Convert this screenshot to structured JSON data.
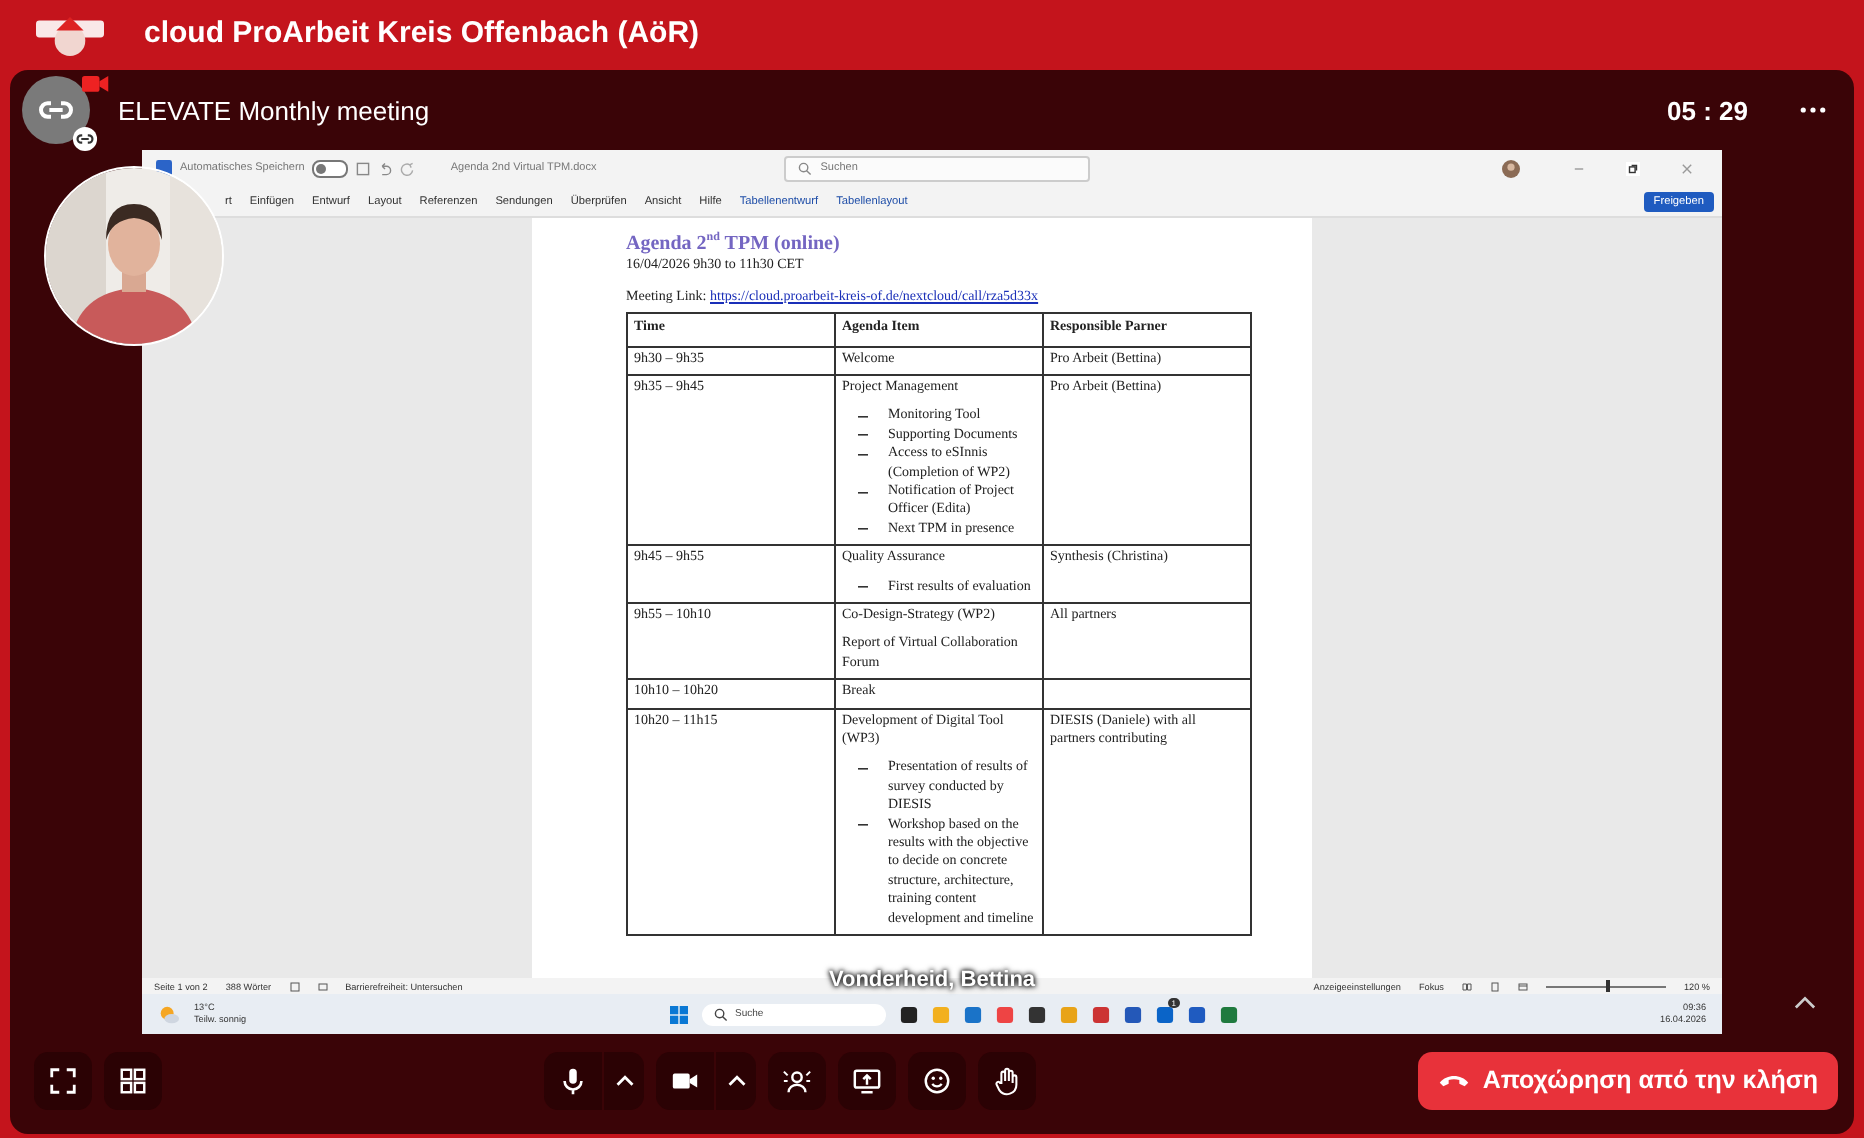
{
  "app_bar": {
    "title": "cloud ProArbeit Kreis Offenbach (AöR)"
  },
  "call": {
    "title": "ELEVATE Monthly meeting",
    "timer": "05 : 29"
  },
  "word": {
    "autosave_label": "Automatisches Speichern",
    "autosave_on": false,
    "file_name": "Agenda 2nd Virtual TPM.docx",
    "search_placeholder": "Suchen",
    "share_button": "Freigeben",
    "ribbon_tabs": [
      {
        "label": "rt",
        "kind": "normal"
      },
      {
        "label": "Einfügen",
        "kind": "normal"
      },
      {
        "label": "Entwurf",
        "kind": "normal"
      },
      {
        "label": "Layout",
        "kind": "normal"
      },
      {
        "label": "Referenzen",
        "kind": "normal"
      },
      {
        "label": "Sendungen",
        "kind": "normal"
      },
      {
        "label": "Überprüfen",
        "kind": "normal"
      },
      {
        "label": "Ansicht",
        "kind": "normal"
      },
      {
        "label": "Hilfe",
        "kind": "normal"
      },
      {
        "label": "Tabellenentwurf",
        "kind": "context"
      },
      {
        "label": "Tabellenlayout",
        "kind": "context"
      }
    ]
  },
  "document": {
    "title": "Agenda 2$^{nd}$ TPM (online)",
    "date_line": "16/04/2026 9h30 to 11h30 CET",
    "link_label": "Meeting Link:",
    "link": "https://cloud.proarbeit-kreis-of.de/nextcloud/call/rza5d33x",
    "columns": [
      "Time",
      "Agenda Item",
      "Responsible Parner"
    ],
    "rows": [
      {
        "time": "9h30 – 9h35",
        "paragraphs": [
          "Welcome"
        ],
        "partner": "Pro Arbeit (Bettina)"
      },
      {
        "time": "9h35 – 9h45",
        "paragraphs": [
          "Project Management"
        ],
        "bullets": [
          "Monitoring Tool",
          "Supporting Documents",
          "Access to eSInnis (Completion of WP2)",
          "Notification of Project Officer (Edita)",
          "Next TPM in presence"
        ],
        "partner": "Pro Arbeit (Bettina)"
      },
      {
        "time": "9h45 – 9h55",
        "paragraphs": [
          "Quality Assurance"
        ],
        "bullets": [
          "First results of evaluation"
        ],
        "partner": "Synthesis (Christina)"
      },
      {
        "time": "9h55 – 10h10",
        "paragraphs": [
          "Co-Design-Strategy (WP2)",
          "Report of Virtual Collaboration Forum"
        ],
        "partner": "All partners"
      },
      {
        "time": "10h10 – 10h20",
        "paragraphs": [
          "Break"
        ]
      },
      {
        "time": "10h20 – 11h15",
        "paragraphs": [
          "Development of Digital Tool (WP3)"
        ],
        "bullets": [
          "Presentation of results of survey conducted by DIESIS",
          "Workshop based on the results with the objective to decide on concrete structure, architecture, training content development and timeline"
        ],
        "partner": "DIESIS (Daniele) with all partners contributing"
      }
    ]
  },
  "status_bar": {
    "page": "Seite 1 von 2",
    "words": "388 Wörter",
    "accessibility": "Barrierefreiheit: Untersuchen",
    "display_settings": "Anzeigeeinstellungen",
    "focus": "Fokus",
    "zoom_slider": {
      "level": 0.5
    },
    "zoom": "120 %"
  },
  "taskbar": {
    "temperature": "13°C",
    "weather": "Teilw. sonnig",
    "search_placeholder": "Suche",
    "time": "09:36",
    "date": "16.04.2026",
    "badge": "1"
  },
  "presenter_name": "Vonderheid, Bettina",
  "controls": {
    "leave_button": "Αποχώρηση από την κλήση"
  }
}
